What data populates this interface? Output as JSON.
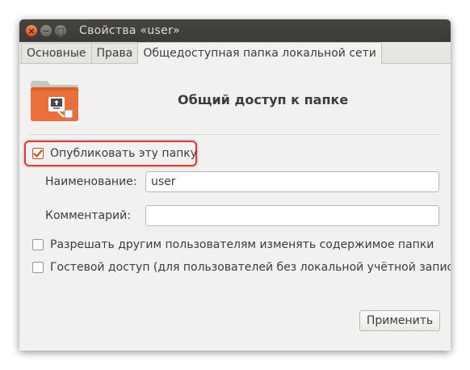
{
  "window": {
    "title": "Свойства «user»",
    "controls": [
      {
        "icon": "close-icon",
        "glyph": "×"
      },
      {
        "icon": "minimize-icon",
        "glyph": "−"
      },
      {
        "icon": "maximize-icon",
        "glyph": "□"
      }
    ]
  },
  "tabs": [
    {
      "label": "Основные",
      "active": false
    },
    {
      "label": "Права",
      "active": false
    },
    {
      "label": "Общедоступная папка локальной сети",
      "active": true
    }
  ],
  "header": {
    "icon": "shared-folder-icon",
    "title": "Общий доступ к папке"
  },
  "publish": {
    "label": "Опубликовать эту папку",
    "checked": true
  },
  "fields": {
    "name_label": "Наименование:",
    "name_value": "user",
    "comment_label": "Комментарий:",
    "comment_value": ""
  },
  "options": [
    {
      "label": "Разрешать другим пользователям изменять содержимое папки",
      "checked": false
    },
    {
      "label": "Гостевой доступ (для пользователей без локальной учётной записи)",
      "checked": false
    }
  ],
  "apply_label": "Применить",
  "colors": {
    "accent": "#dd4814",
    "highlight_border": "#d93a3a",
    "titlebar": "#3c3b37"
  }
}
